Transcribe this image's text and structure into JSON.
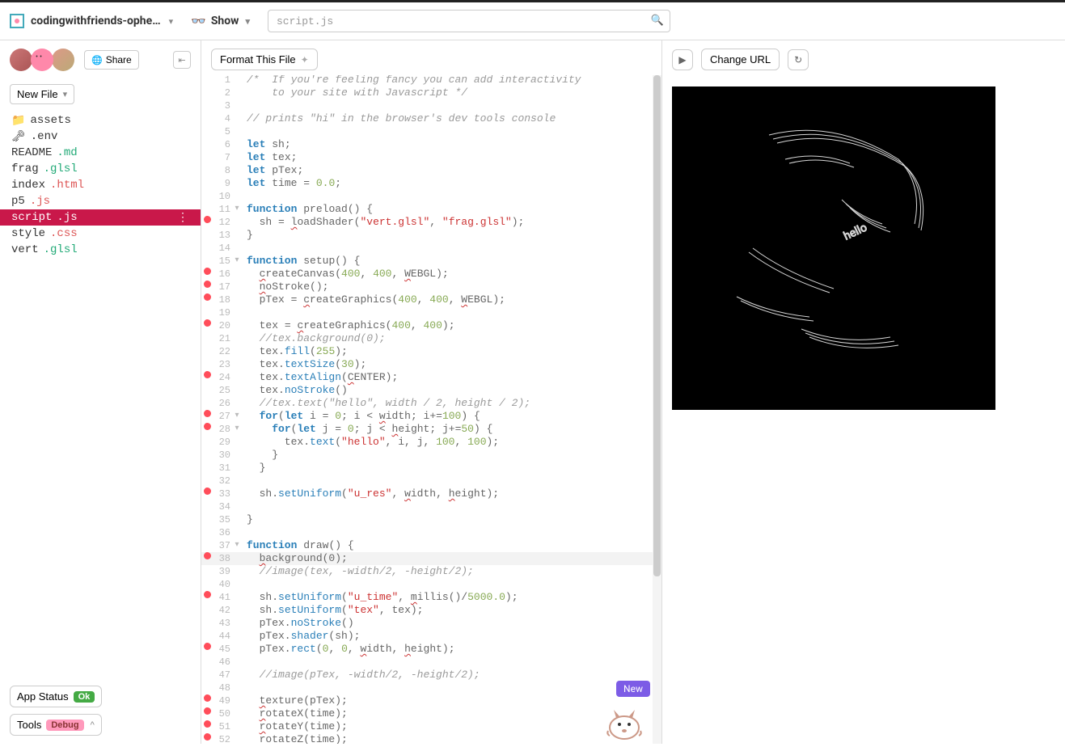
{
  "header": {
    "project_name": "codingwithfriends-ophe…",
    "show_label": "Show",
    "search_value": "script.js"
  },
  "sidebar": {
    "share_label": "Share",
    "newfile_label": "New File",
    "files": [
      {
        "icon": "📁",
        "name": "assets",
        "ext": ""
      },
      {
        "icon": "🗝",
        "name": ".env",
        "ext": ""
      },
      {
        "icon": "",
        "name": "README",
        "ext": ".md",
        "ext_class": "ext-md"
      },
      {
        "icon": "",
        "name": "frag",
        "ext": ".glsl",
        "ext_class": "ext-glsl"
      },
      {
        "icon": "",
        "name": "index",
        "ext": ".html",
        "ext_class": "ext-html"
      },
      {
        "icon": "",
        "name": "p5",
        "ext": ".js",
        "ext_class": "ext-js"
      },
      {
        "icon": "",
        "name": "script",
        "ext": ".js",
        "ext_class": "ext-js",
        "active": true
      },
      {
        "icon": "",
        "name": "style",
        "ext": ".css",
        "ext_class": "ext-css"
      },
      {
        "icon": "",
        "name": "vert",
        "ext": ".glsl",
        "ext_class": "ext-glsl"
      }
    ],
    "app_status_label": "App Status",
    "app_status_badge": "Ok",
    "tools_label": "Tools",
    "tools_badge": "Debug"
  },
  "editor": {
    "format_label": "Format This File",
    "lines": [
      {
        "n": 1,
        "marker": false,
        "fold": "",
        "hl": false,
        "html": "<span class='c-comment'>/*  If you're feeling fancy you can add interactivity </span>"
      },
      {
        "n": 2,
        "marker": false,
        "fold": "",
        "hl": false,
        "html": "<span class='c-comment'>    to your site with Javascript */</span>"
      },
      {
        "n": 3,
        "marker": false,
        "fold": "",
        "hl": false,
        "html": ""
      },
      {
        "n": 4,
        "marker": false,
        "fold": "",
        "hl": false,
        "html": "<span class='c-comment'>// prints \"hi\" in the browser's dev tools console</span>"
      },
      {
        "n": 5,
        "marker": false,
        "fold": "",
        "hl": false,
        "html": ""
      },
      {
        "n": 6,
        "marker": false,
        "fold": "",
        "hl": false,
        "html": "<span class='c-kw'>let</span> <span class='c-id'>sh</span>;"
      },
      {
        "n": 7,
        "marker": false,
        "fold": "",
        "hl": false,
        "html": "<span class='c-kw'>let</span> <span class='c-id'>tex</span>;"
      },
      {
        "n": 8,
        "marker": false,
        "fold": "",
        "hl": false,
        "html": "<span class='c-kw'>let</span> <span class='c-id'>pTex</span>;"
      },
      {
        "n": 9,
        "marker": false,
        "fold": "",
        "hl": false,
        "html": "<span class='c-kw'>let</span> <span class='c-id'>time</span> <span class='c-op'>=</span> <span class='c-num'>0.0</span>;"
      },
      {
        "n": 10,
        "marker": false,
        "fold": "",
        "hl": false,
        "html": ""
      },
      {
        "n": 11,
        "marker": false,
        "fold": "▾",
        "hl": false,
        "html": "<span class='c-kw'>function</span> <span class='c-id'>preload</span>() {"
      },
      {
        "n": 12,
        "marker": true,
        "fold": "",
        "hl": false,
        "html": "  sh <span class='c-op'>=</span> <span class='c-underline'>l</span>oadShader(<span class='c-str'>\"vert.glsl\"</span>, <span class='c-str'>\"frag.glsl\"</span>);"
      },
      {
        "n": 13,
        "marker": false,
        "fold": "",
        "hl": false,
        "html": "}"
      },
      {
        "n": 14,
        "marker": false,
        "fold": "",
        "hl": false,
        "html": ""
      },
      {
        "n": 15,
        "marker": false,
        "fold": "▾",
        "hl": false,
        "html": "<span class='c-kw'>function</span> <span class='c-id'>setup</span>() {"
      },
      {
        "n": 16,
        "marker": true,
        "fold": "",
        "hl": false,
        "html": "  <span class='c-underline'>c</span>reateCanvas(<span class='c-num'>400</span>, <span class='c-num'>400</span>, <span class='c-underline'>W</span>EBGL);"
      },
      {
        "n": 17,
        "marker": true,
        "fold": "",
        "hl": false,
        "html": "  <span class='c-underline'>n</span>oStroke();"
      },
      {
        "n": 18,
        "marker": true,
        "fold": "",
        "hl": false,
        "html": "  pTex <span class='c-op'>=</span> <span class='c-underline'>c</span>reateGraphics(<span class='c-num'>400</span>, <span class='c-num'>400</span>, <span class='c-underline'>W</span>EBGL);"
      },
      {
        "n": 19,
        "marker": false,
        "fold": "",
        "hl": false,
        "html": ""
      },
      {
        "n": 20,
        "marker": true,
        "fold": "",
        "hl": false,
        "html": "  tex <span class='c-op'>=</span> <span class='c-underline'>c</span>reateGraphics(<span class='c-num'>400</span>, <span class='c-num'>400</span>);"
      },
      {
        "n": 21,
        "marker": false,
        "fold": "",
        "hl": false,
        "html": "  <span class='c-comment'>//tex.background(0);</span>"
      },
      {
        "n": 22,
        "marker": false,
        "fold": "",
        "hl": false,
        "html": "  tex.<span class='c-func'>fill</span>(<span class='c-num'>255</span>);"
      },
      {
        "n": 23,
        "marker": false,
        "fold": "",
        "hl": false,
        "html": "  tex.<span class='c-func'>textSize</span>(<span class='c-num'>30</span>);"
      },
      {
        "n": 24,
        "marker": true,
        "fold": "",
        "hl": false,
        "html": "  tex.<span class='c-func'>textAlign</span>(<span class='c-underline'>C</span>ENTER);"
      },
      {
        "n": 25,
        "marker": false,
        "fold": "",
        "hl": false,
        "html": "  tex.<span class='c-func'>noStroke</span>()"
      },
      {
        "n": 26,
        "marker": false,
        "fold": "",
        "hl": false,
        "html": "  <span class='c-comment'>//tex.text(\"hello\", width / 2, height / 2);</span>"
      },
      {
        "n": 27,
        "marker": true,
        "fold": "▾",
        "hl": false,
        "html": "  <span class='c-kw'>for</span>(<span class='c-kw'>let</span> i <span class='c-op'>=</span> <span class='c-num'>0</span>; i <span class='c-op'>&lt;</span> <span class='c-underline'>w</span>idth; i<span class='c-op'>+=</span><span class='c-num'>100</span>) {"
      },
      {
        "n": 28,
        "marker": true,
        "fold": "▾",
        "hl": false,
        "html": "    <span class='c-kw'>for</span>(<span class='c-kw'>let</span> j <span class='c-op'>=</span> <span class='c-num'>0</span>; j <span class='c-op'>&lt;</span> <span class='c-underline'>h</span>eight; j<span class='c-op'>+=</span><span class='c-num'>50</span>) {"
      },
      {
        "n": 29,
        "marker": false,
        "fold": "",
        "hl": false,
        "html": "      tex.<span class='c-func'>text</span>(<span class='c-str'>\"hello\"</span>, i, j, <span class='c-num'>100</span>, <span class='c-num'>100</span>);"
      },
      {
        "n": 30,
        "marker": false,
        "fold": "",
        "hl": false,
        "html": "    }"
      },
      {
        "n": 31,
        "marker": false,
        "fold": "",
        "hl": false,
        "html": "  }"
      },
      {
        "n": 32,
        "marker": false,
        "fold": "",
        "hl": false,
        "html": ""
      },
      {
        "n": 33,
        "marker": true,
        "fold": "",
        "hl": false,
        "html": "  sh.<span class='c-func'>setUniform</span>(<span class='c-str'>\"u_res\"</span>, <span class='c-underline'>w</span>idth, <span class='c-underline'>h</span>eight);"
      },
      {
        "n": 34,
        "marker": false,
        "fold": "",
        "hl": false,
        "html": ""
      },
      {
        "n": 35,
        "marker": false,
        "fold": "",
        "hl": false,
        "html": "}"
      },
      {
        "n": 36,
        "marker": false,
        "fold": "",
        "hl": false,
        "html": ""
      },
      {
        "n": 37,
        "marker": false,
        "fold": "▾",
        "hl": false,
        "html": "<span class='c-kw'>function</span> <span class='c-id'>draw</span>() {"
      },
      {
        "n": 38,
        "marker": true,
        "fold": "",
        "hl": true,
        "html": "  <span class='c-underline'>b</span>ackground(0);"
      },
      {
        "n": 39,
        "marker": false,
        "fold": "",
        "hl": false,
        "html": "  <span class='c-comment'>//image(tex, -width/2, -height/2);</span>"
      },
      {
        "n": 40,
        "marker": false,
        "fold": "",
        "hl": false,
        "html": ""
      },
      {
        "n": 41,
        "marker": true,
        "fold": "",
        "hl": false,
        "html": "  sh.<span class='c-func'>setUniform</span>(<span class='c-str'>\"u_time\"</span>, <span class='c-underline'>m</span>illis()/<span class='c-num'>5000.0</span>);"
      },
      {
        "n": 42,
        "marker": false,
        "fold": "",
        "hl": false,
        "html": "  sh.<span class='c-func'>setUniform</span>(<span class='c-str'>\"tex\"</span>, tex);"
      },
      {
        "n": 43,
        "marker": false,
        "fold": "",
        "hl": false,
        "html": "  pTex.<span class='c-func'>noStroke</span>()"
      },
      {
        "n": 44,
        "marker": false,
        "fold": "",
        "hl": false,
        "html": "  pTex.<span class='c-func'>shader</span>(sh);"
      },
      {
        "n": 45,
        "marker": true,
        "fold": "",
        "hl": false,
        "html": "  pTex.<span class='c-func'>rect</span>(<span class='c-num'>0</span>, <span class='c-num'>0</span>, <span class='c-underline'>w</span>idth, <span class='c-underline'>h</span>eight);"
      },
      {
        "n": 46,
        "marker": false,
        "fold": "",
        "hl": false,
        "html": ""
      },
      {
        "n": 47,
        "marker": false,
        "fold": "",
        "hl": false,
        "html": "  <span class='c-comment'>//image(pTex, -width/2, -height/2);</span>"
      },
      {
        "n": 48,
        "marker": false,
        "fold": "",
        "hl": false,
        "html": ""
      },
      {
        "n": 49,
        "marker": true,
        "fold": "",
        "hl": false,
        "html": "  <span class='c-underline'>t</span>exture(pTex);"
      },
      {
        "n": 50,
        "marker": true,
        "fold": "",
        "hl": false,
        "html": "  <span class='c-underline'>r</span>otateX(time);"
      },
      {
        "n": 51,
        "marker": true,
        "fold": "",
        "hl": false,
        "html": "  <span class='c-underline'>r</span>otateY(time);"
      },
      {
        "n": 52,
        "marker": true,
        "fold": "",
        "hl": false,
        "html": "  <span class='c-underline'>r</span>otateZ(time);"
      }
    ]
  },
  "preview": {
    "change_url_label": "Change URL",
    "mascot_badge": "New"
  }
}
